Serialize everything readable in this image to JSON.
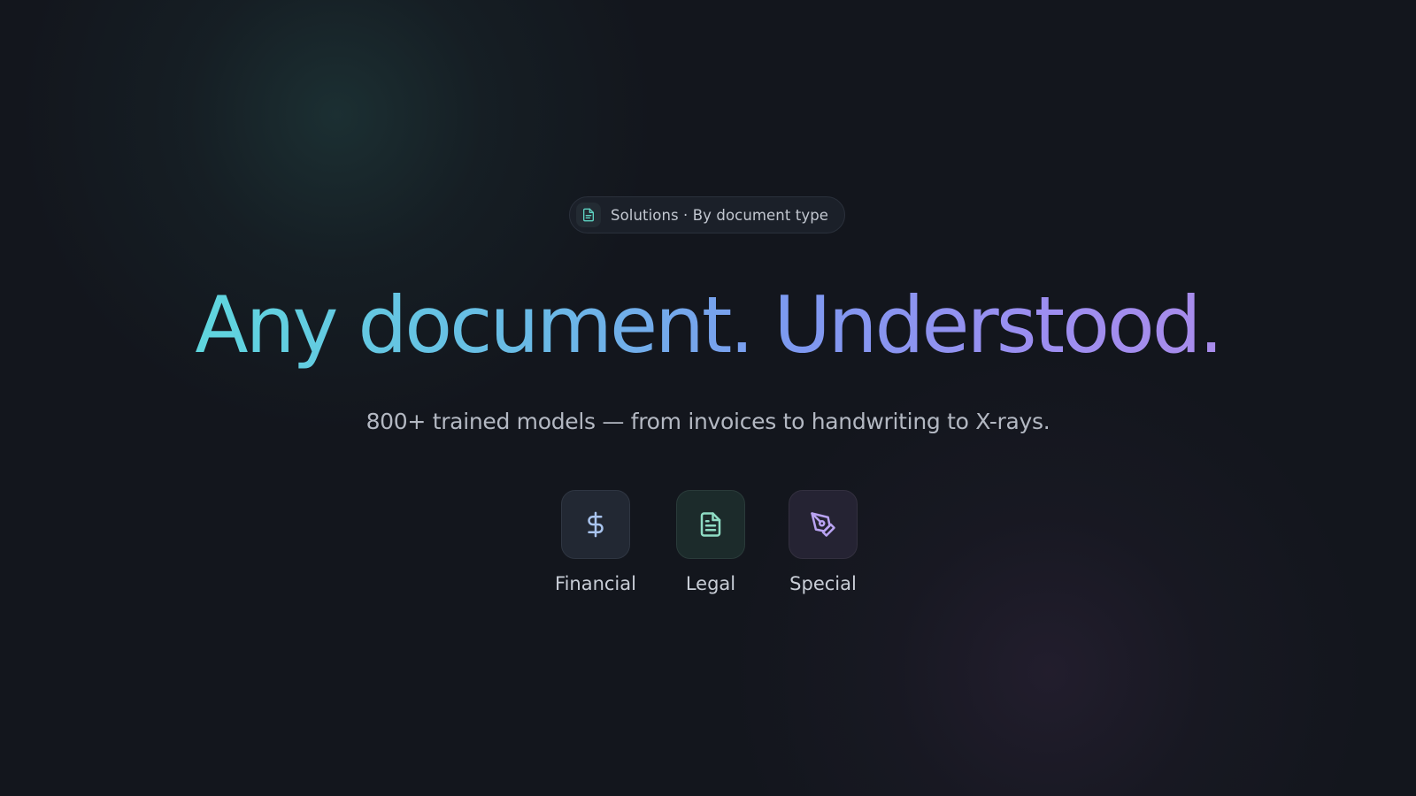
{
  "badge": {
    "icon": "document-icon",
    "text": "Solutions · By document type"
  },
  "hero": {
    "headline": "Any document. Understood.",
    "subtitle": "800+ trained models — from invoices to handwriting to X-rays."
  },
  "categories": [
    {
      "label": "Financial",
      "icon": "dollar-icon",
      "color": "#a9c4ee"
    },
    {
      "label": "Legal",
      "icon": "document-icon",
      "color": "#8fdcc4"
    },
    {
      "label": "Special",
      "icon": "pen-tool-icon",
      "color": "#b9a3f2"
    }
  ],
  "colors": {
    "background": "#13161d",
    "gradient_start": "#5fd6de",
    "gradient_end": "#a98ceb",
    "badge_icon": "#5ed1c1"
  }
}
